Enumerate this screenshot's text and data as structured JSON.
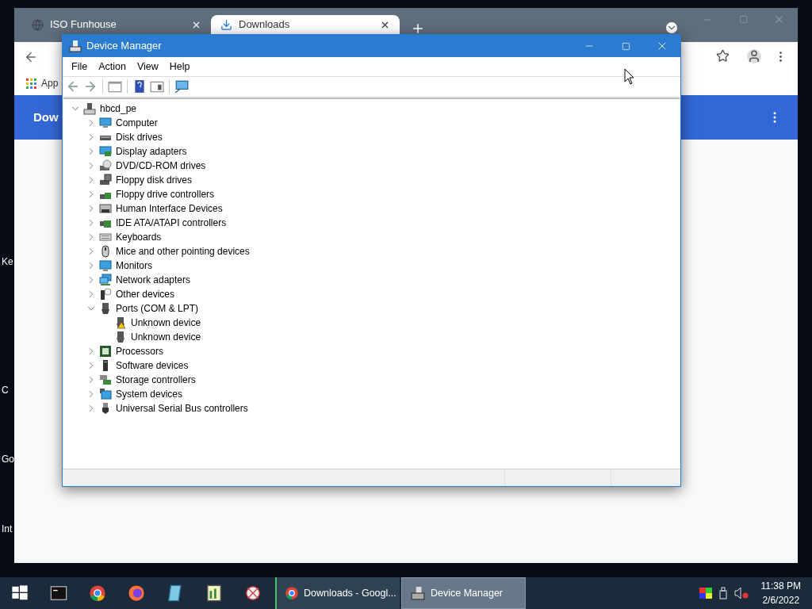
{
  "desktop_icons": [
    {
      "label": "Ke"
    },
    {
      "label": "C"
    },
    {
      "label": "Go"
    },
    {
      "label": "Int"
    }
  ],
  "browser": {
    "tabs": [
      {
        "label": "ISO Funhouse",
        "selected": false
      },
      {
        "label": "Downloads",
        "selected": true
      }
    ],
    "bookmarks": [
      "App"
    ],
    "header_title": "Dow"
  },
  "device_manager": {
    "title": "Device Manager",
    "menu": [
      "File",
      "Action",
      "View",
      "Help"
    ],
    "tree": {
      "label": "hbcd_pe",
      "expanded": true,
      "children": [
        {
          "label": "Computer",
          "expanded": false
        },
        {
          "label": "Disk drives",
          "expanded": false
        },
        {
          "label": "Display adapters",
          "expanded": false
        },
        {
          "label": "DVD/CD-ROM drives",
          "expanded": false
        },
        {
          "label": "Floppy disk drives",
          "expanded": false
        },
        {
          "label": "Floppy drive controllers",
          "expanded": false
        },
        {
          "label": "Human Interface Devices",
          "expanded": false
        },
        {
          "label": "IDE ATA/ATAPI controllers",
          "expanded": false
        },
        {
          "label": "Keyboards",
          "expanded": false
        },
        {
          "label": "Mice and other pointing devices",
          "expanded": false
        },
        {
          "label": "Monitors",
          "expanded": false
        },
        {
          "label": "Network adapters",
          "expanded": false
        },
        {
          "label": "Other devices",
          "expanded": false
        },
        {
          "label": "Ports (COM & LPT)",
          "expanded": true,
          "children": [
            {
              "label": "Unknown device",
              "warning": true
            },
            {
              "label": "Unknown device",
              "warning": false
            }
          ]
        },
        {
          "label": "Processors",
          "expanded": false
        },
        {
          "label": "Software devices",
          "expanded": false
        },
        {
          "label": "Storage controllers",
          "expanded": false
        },
        {
          "label": "System devices",
          "expanded": false
        },
        {
          "label": "Universal Serial Bus controllers",
          "expanded": false
        }
      ]
    }
  },
  "taskbar": {
    "tasks": [
      {
        "label": "Downloads - Googl...",
        "selected": false
      },
      {
        "label": "Device Manager",
        "selected": true
      }
    ],
    "time": "11:38 PM",
    "date": "2/6/2022"
  }
}
